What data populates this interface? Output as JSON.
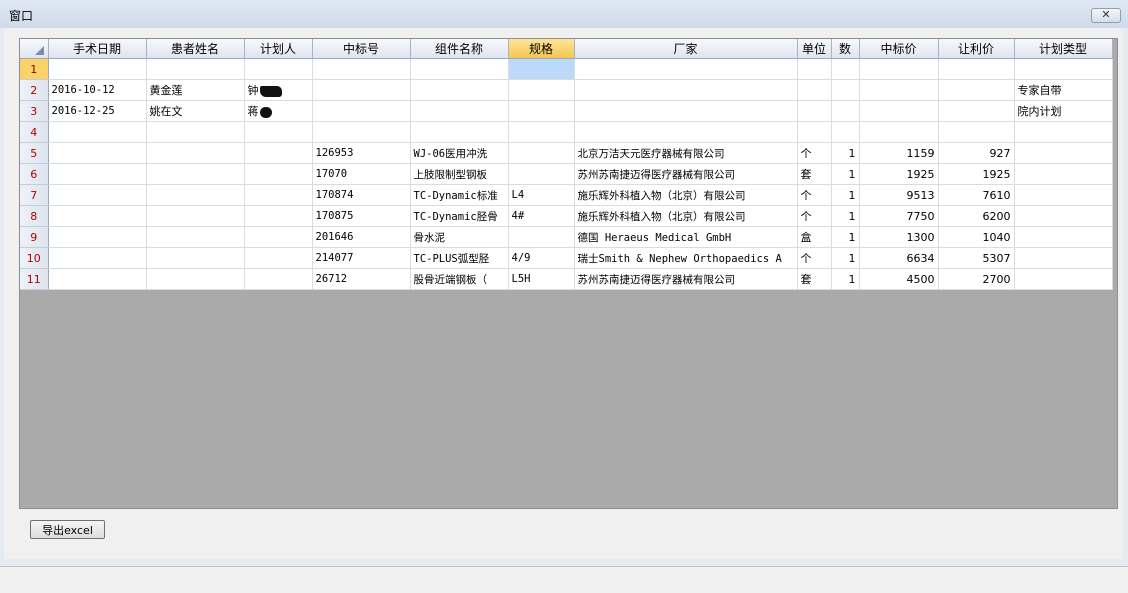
{
  "window": {
    "title": "窗口",
    "close_label": "✕"
  },
  "grid": {
    "columns": [
      "手术日期",
      "患者姓名",
      "计划人",
      "中标号",
      "组件名称",
      "规格",
      "厂家",
      "单位",
      "数",
      "中标价",
      "让利价",
      "计划类型"
    ],
    "selected_column_index": 5,
    "selected_row_index": 0,
    "rows": [
      {
        "n": "1",
        "date": "",
        "patient": "",
        "planner": "",
        "bid_no": "",
        "component": "",
        "spec": "",
        "maker": "",
        "unit": "",
        "qty": "",
        "bid_price": "",
        "discount_price": "",
        "plan_type": ""
      },
      {
        "n": "2",
        "date": "2016-10-12",
        "patient": "黄金莲",
        "planner": "钟",
        "bid_no": "",
        "component": "",
        "spec": "",
        "maker": "",
        "unit": "",
        "qty": "",
        "bid_price": "",
        "discount_price": "",
        "plan_type": "专家自带"
      },
      {
        "n": "3",
        "date": "2016-12-25",
        "patient": "姚在文",
        "planner": "蒋",
        "bid_no": "",
        "component": "",
        "spec": "",
        "maker": "",
        "unit": "",
        "qty": "",
        "bid_price": "",
        "discount_price": "",
        "plan_type": "院内计划"
      },
      {
        "n": "4",
        "date": "",
        "patient": "",
        "planner": "",
        "bid_no": "",
        "component": "",
        "spec": "",
        "maker": "",
        "unit": "",
        "qty": "",
        "bid_price": "",
        "discount_price": "",
        "plan_type": ""
      },
      {
        "n": "5",
        "date": "",
        "patient": "",
        "planner": "",
        "bid_no": "126953",
        "component": "WJ-06医用冲洗",
        "spec": "",
        "maker": "北京万洁天元医疗器械有限公司",
        "unit": "个",
        "qty": "1",
        "bid_price": "1159",
        "discount_price": "927",
        "plan_type": ""
      },
      {
        "n": "6",
        "date": "",
        "patient": "",
        "planner": "",
        "bid_no": "17070",
        "component": "上肢限制型钢板",
        "spec": "",
        "maker": "苏州苏南捷迈得医疗器械有限公司",
        "unit": "套",
        "qty": "1",
        "bid_price": "1925",
        "discount_price": "1925",
        "plan_type": ""
      },
      {
        "n": "7",
        "date": "",
        "patient": "",
        "planner": "",
        "bid_no": "170874",
        "component": "TC-Dynamic标准",
        "spec": "L4",
        "maker": "施乐辉外科植入物（北京）有限公司",
        "unit": "个",
        "qty": "1",
        "bid_price": "9513",
        "discount_price": "7610",
        "plan_type": ""
      },
      {
        "n": "8",
        "date": "",
        "patient": "",
        "planner": "",
        "bid_no": "170875",
        "component": "TC-Dynamic胫骨",
        "spec": "4#",
        "maker": "施乐辉外科植入物（北京）有限公司",
        "unit": "个",
        "qty": "1",
        "bid_price": "7750",
        "discount_price": "6200",
        "plan_type": ""
      },
      {
        "n": "9",
        "date": "",
        "patient": "",
        "planner": "",
        "bid_no": "201646",
        "component": "骨水泥",
        "spec": "",
        "maker": "德国 Heraeus Medical GmbH",
        "unit": "盒",
        "qty": "1",
        "bid_price": "1300",
        "discount_price": "1040",
        "plan_type": ""
      },
      {
        "n": "10",
        "date": "",
        "patient": "",
        "planner": "",
        "bid_no": "214077",
        "component": "TC-PLUS弧型胫",
        "spec": "4/9",
        "maker": "瑞士Smith & Nephew Orthopaedics A",
        "unit": "个",
        "qty": "1",
        "bid_price": "6634",
        "discount_price": "5307",
        "plan_type": ""
      },
      {
        "n": "11",
        "date": "",
        "patient": "",
        "planner": "",
        "bid_no": "26712",
        "component": "股骨近端钢板（",
        "spec": "L5H",
        "maker": "苏州苏南捷迈得医疗器械有限公司",
        "unit": "套",
        "qty": "1",
        "bid_price": "4500",
        "discount_price": "2700",
        "plan_type": ""
      }
    ]
  },
  "actions": {
    "export_label": "导出excel"
  },
  "colors": {
    "selected_header": "#f6c651",
    "selected_cell": "#bcd9f7",
    "row_number": "#b00000",
    "empty_area": "#aaaaaa"
  }
}
